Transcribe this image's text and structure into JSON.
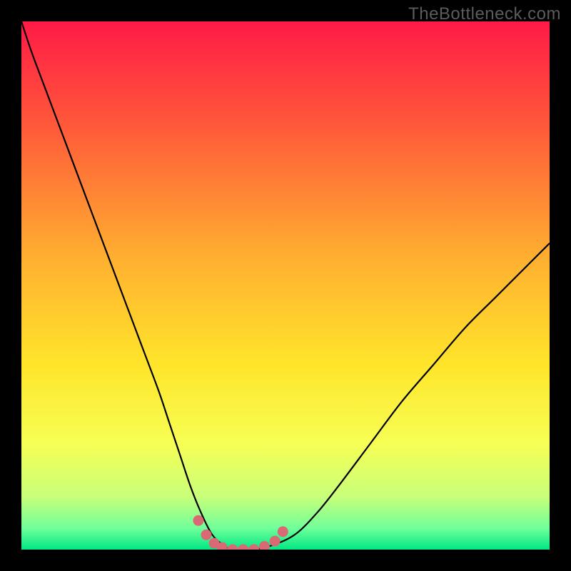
{
  "watermark": "TheBottleneck.com",
  "chart_data": {
    "type": "line",
    "title": "",
    "xlabel": "",
    "ylabel": "",
    "xlim": [
      0,
      100
    ],
    "ylim": [
      0,
      100
    ],
    "background_gradient": {
      "stops": [
        {
          "pos": 0.0,
          "color": "#ff1a46"
        },
        {
          "pos": 0.2,
          "color": "#ff5a3a"
        },
        {
          "pos": 0.45,
          "color": "#ffb030"
        },
        {
          "pos": 0.65,
          "color": "#ffe52a"
        },
        {
          "pos": 0.8,
          "color": "#f7ff55"
        },
        {
          "pos": 0.9,
          "color": "#c8ff7a"
        },
        {
          "pos": 0.96,
          "color": "#6fff9a"
        },
        {
          "pos": 1.0,
          "color": "#00e884"
        }
      ]
    },
    "series": [
      {
        "name": "bottleneck-curve",
        "color": "#000000",
        "x": [
          0,
          2,
          5,
          8,
          11,
          14,
          17,
          20,
          23,
          26,
          28,
          30,
          32,
          34,
          36,
          38,
          40,
          44,
          48,
          52,
          56,
          60,
          66,
          72,
          78,
          84,
          90,
          96,
          100
        ],
        "y": [
          100,
          94,
          86,
          78,
          70,
          62,
          54,
          46,
          38,
          30,
          24,
          18,
          12,
          7,
          3,
          1,
          0,
          0,
          1,
          3,
          7,
          12,
          20,
          28,
          35,
          42,
          48,
          54,
          58
        ]
      }
    ],
    "markers": {
      "name": "optimal-range-dots",
      "color": "#d96a75",
      "x": [
        33.5,
        35,
        36.5,
        38,
        40,
        42,
        44,
        46,
        48,
        49.5
      ],
      "y": [
        5.5,
        2.8,
        1.2,
        0.4,
        0,
        0,
        0,
        0.6,
        1.6,
        3.4
      ]
    }
  }
}
